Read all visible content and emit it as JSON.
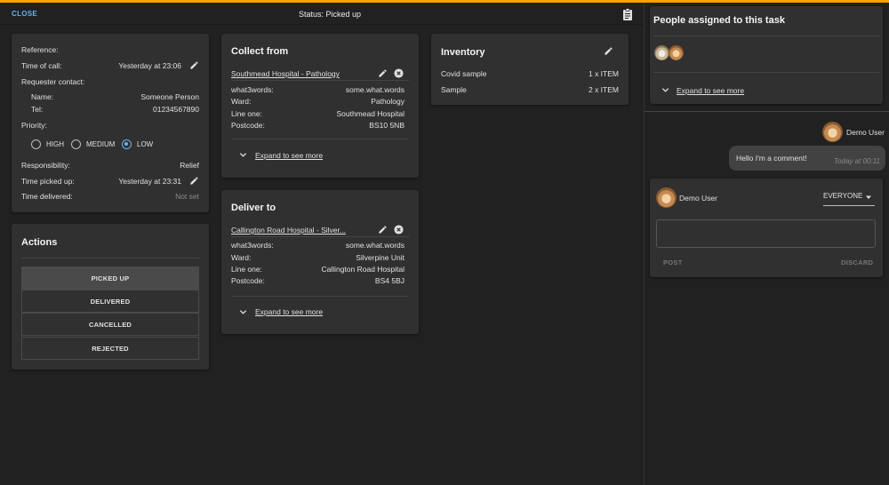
{
  "topbar": {
    "close_label": "CLOSE",
    "status_text": "Status: Picked up"
  },
  "details": {
    "reference_label": "Reference:",
    "time_of_call_label": "Time of call:",
    "time_of_call_value": "Yesterday at 23:06",
    "requester_contact_label": "Requester contact:",
    "name_label": "Name:",
    "name_value": "Someone Person",
    "tel_label": "Tel:",
    "tel_value": "01234567890",
    "priority_label": "Priority:",
    "priority_options": [
      "HIGH",
      "MEDIUM",
      "LOW"
    ],
    "priority_selected": "LOW",
    "responsibility_label": "Responsibility:",
    "responsibility_value": "Relief",
    "time_picked_up_label": "Time picked up:",
    "time_picked_up_value": "Yesterday at 23:31",
    "time_delivered_label": "Time delivered:",
    "time_delivered_value": "Not set"
  },
  "actions": {
    "title": "Actions",
    "buttons": [
      "PICKED UP",
      "DELIVERED",
      "CANCELLED",
      "REJECTED"
    ],
    "active": "PICKED UP"
  },
  "collect": {
    "title": "Collect from",
    "location": "Southmead Hospital - Pathology",
    "fields": [
      {
        "label": "what3words:",
        "value": "some.what.words"
      },
      {
        "label": "Ward:",
        "value": "Pathology"
      },
      {
        "label": "Line one:",
        "value": "Southmead Hospital"
      },
      {
        "label": "Postcode:",
        "value": "BS10 5NB"
      }
    ],
    "expand_label": "Expand to see more"
  },
  "deliver": {
    "title": "Deliver to",
    "location": "Callington Road Hospital - Silver...",
    "fields": [
      {
        "label": "what3words:",
        "value": "some.what.words"
      },
      {
        "label": "Ward:",
        "value": "Silverpine Unit"
      },
      {
        "label": "Line one:",
        "value": "Callington Road Hospital"
      },
      {
        "label": "Postcode:",
        "value": "BS4 5BJ"
      }
    ],
    "expand_label": "Expand to see more"
  },
  "inventory": {
    "title": "Inventory",
    "items": [
      {
        "name": "Covid sample",
        "qty": "1 x ITEM"
      },
      {
        "name": "Sample",
        "qty": "2 x ITEM"
      }
    ]
  },
  "assigned": {
    "title": "People assigned to this task",
    "expand_label": "Expand to see more"
  },
  "comments": {
    "author": "Demo User",
    "text": "Hello I'm a comment!",
    "timestamp": "Today at 00:11"
  },
  "new_comment": {
    "author": "Demo User",
    "visibility": "EVERYONE",
    "post_label": "POST",
    "discard_label": "DISCARD"
  },
  "colors": {
    "accent": "#ffa000",
    "link": "#64b5f6",
    "card": "#303030",
    "background": "#212121"
  }
}
